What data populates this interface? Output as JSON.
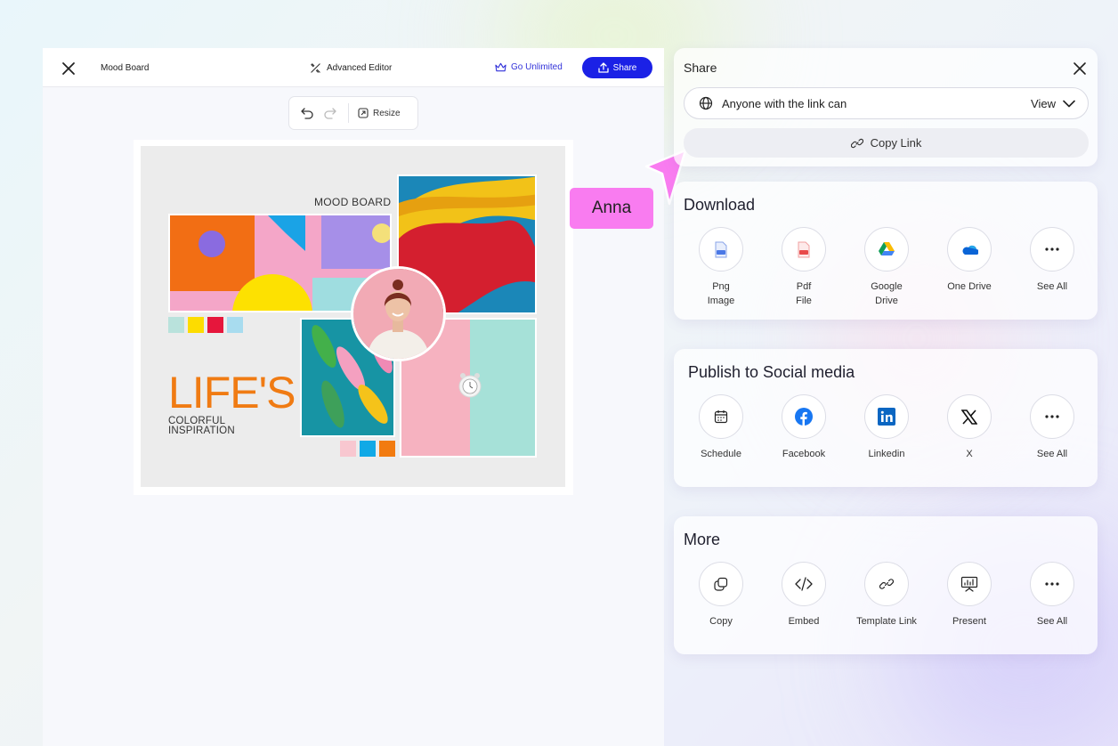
{
  "editor": {
    "title": "Mood Board",
    "advanced_editor": "Advanced Editor",
    "go_unlimited": "Go Unlimited",
    "share_button": "Share",
    "resize": "Resize"
  },
  "canvas": {
    "mood_board": "MOOD BOARD",
    "headline": "LIFE'S",
    "sub1": "COLORFUL",
    "sub2": "INSPIRATION"
  },
  "cursor_label": "Anna",
  "share": {
    "title": "Share",
    "access_label": "Anyone with the link can",
    "access_value": "View",
    "copy_link": "Copy Link"
  },
  "download": {
    "title": "Download",
    "items": [
      {
        "line1": "Png",
        "line2": "Image",
        "icon": "png-file-icon"
      },
      {
        "line1": "Pdf",
        "line2": "File",
        "icon": "pdf-file-icon"
      },
      {
        "line1": "Google",
        "line2": "Drive",
        "icon": "google-drive-icon"
      },
      {
        "line1": "One Drive",
        "line2": "",
        "icon": "onedrive-icon"
      },
      {
        "line1": "See All",
        "line2": "",
        "icon": "more-icon"
      }
    ]
  },
  "social": {
    "title": "Publish to Social media",
    "items": [
      {
        "label": "Schedule",
        "icon": "calendar-icon"
      },
      {
        "label": "Facebook",
        "icon": "facebook-icon"
      },
      {
        "label": "Linkedin",
        "icon": "linkedin-icon"
      },
      {
        "label": "X",
        "icon": "x-icon"
      },
      {
        "label": "See All",
        "icon": "more-icon"
      }
    ]
  },
  "more": {
    "title": "More",
    "items": [
      {
        "label": "Copy",
        "icon": "copy-icon"
      },
      {
        "label": "Embed",
        "icon": "embed-icon"
      },
      {
        "label": "Template Link",
        "icon": "link-icon"
      },
      {
        "label": "Present",
        "icon": "present-icon"
      },
      {
        "label": "See All",
        "icon": "more-icon"
      }
    ]
  },
  "colors": {
    "primary": "#1b21e6",
    "accent_orange": "#f07b13",
    "cursor_pink": "#f97cf0"
  }
}
